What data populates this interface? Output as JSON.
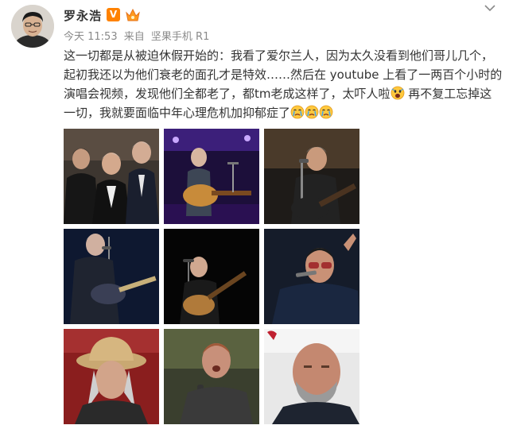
{
  "post": {
    "username": "罗永浩",
    "vip_badge": "V",
    "time": "今天 11:53",
    "source_prefix": "来自",
    "source": "坚果手机 R1",
    "text_main": "这一切都是从被迫休假开始的：我看了爱尔兰人，因为太久没看到他们哥儿几个，起初我还以为他们衰老的面孔才是特效……然后在 youtube 上看了一两百个小时的演唱会视频，发现他们全都老了，都tm老成这样了，太吓人啦",
    "text_tail": "再不复工忘掉这一切，我就要面临中年心理危机加抑郁症了",
    "emojis": [
      "scared-face",
      "crying-face",
      "crying-face",
      "crying-face"
    ],
    "photos": [
      {
        "name": "photo-red-carpet-trio"
      },
      {
        "name": "photo-guitarist-stage-purple"
      },
      {
        "name": "photo-guitarist-singing"
      },
      {
        "name": "photo-guitarist-dark-blue"
      },
      {
        "name": "photo-guitarist-dark-stage"
      },
      {
        "name": "photo-singer-sunglasses"
      },
      {
        "name": "photo-man-straw-hat"
      },
      {
        "name": "photo-singer-microphone"
      },
      {
        "name": "photo-bald-man-beard"
      }
    ],
    "icons": {
      "more": "chevron-down-icon",
      "level": "crown-icon"
    },
    "colors": {
      "vip": "#ff8200",
      "meta": "#8a8a8a",
      "text": "#333333"
    }
  }
}
